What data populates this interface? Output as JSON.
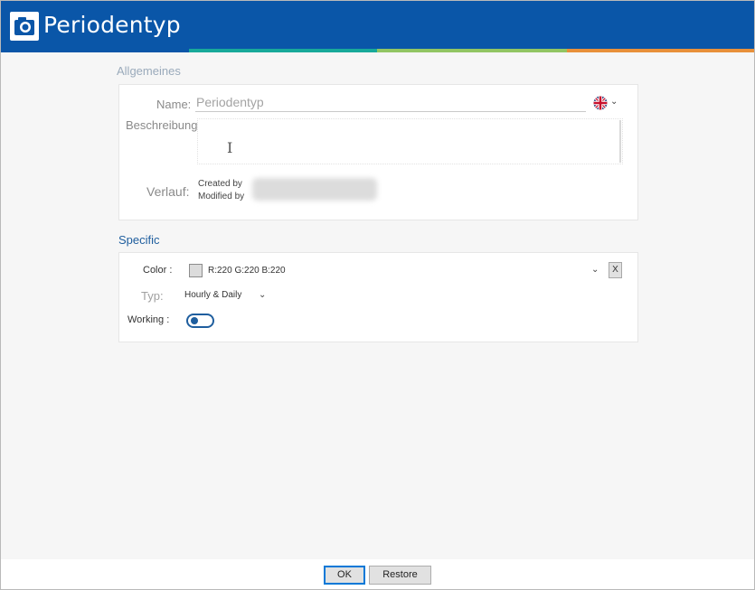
{
  "window": {
    "title": "Periodentyp",
    "accent_colors": [
      "#0a56a8",
      "#18a99a",
      "#92c563",
      "#e8903a"
    ]
  },
  "general": {
    "section_title": "Allgemeines",
    "name_label": "Name:",
    "name_placeholder": "Periodentyp",
    "language_icon": "uk-flag-icon",
    "description_label": "Beschreibung:",
    "history_label": "Verlauf:",
    "created_by": "Created by",
    "modified_by": "Modified by"
  },
  "specific": {
    "section_title": "Specific",
    "color_label": "Color :",
    "color_value": "R:220 G:220 B:220",
    "color_swatch": "#dcdcdc",
    "clear_label": "X",
    "typ_label": "Typ:",
    "typ_value": "Hourly & Daily",
    "working_label": "Working :",
    "working_on": false
  },
  "footer": {
    "ok_label": "OK",
    "restore_label": "Restore"
  }
}
